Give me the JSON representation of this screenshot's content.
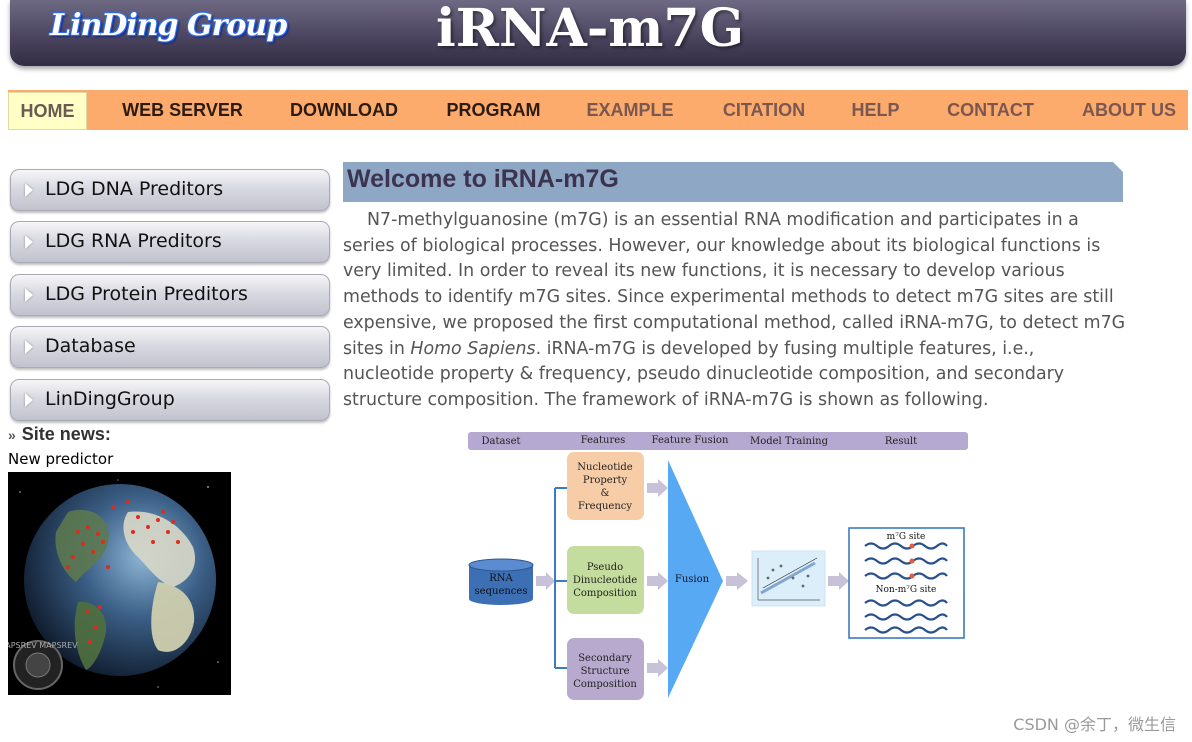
{
  "header": {
    "logo_text": "LinDing Group",
    "title": "iRNA-m7G"
  },
  "nav": {
    "items": [
      {
        "label": "HOME",
        "state": "active"
      },
      {
        "label": "WEB SERVER",
        "state": "normal"
      },
      {
        "label": "DOWNLOAD",
        "state": "normal"
      },
      {
        "label": "PROGRAM",
        "state": "normal"
      },
      {
        "label": "EXAMPLE",
        "state": "dim"
      },
      {
        "label": "CITATION",
        "state": "dim"
      },
      {
        "label": "HELP",
        "state": "dim"
      },
      {
        "label": "CONTACT",
        "state": "dim"
      },
      {
        "label": "ABOUT US",
        "state": "dim"
      }
    ]
  },
  "sidebar": {
    "items": [
      {
        "label": "LDG DNA Preditors"
      },
      {
        "label": "LDG RNA Preditors"
      },
      {
        "label": "LDG Protein Preditors"
      },
      {
        "label": "Database"
      },
      {
        "label": "LinDingGroup"
      }
    ],
    "news_title": "Site news:",
    "news_item": "New predictor",
    "globe_stamp": "MAPSREV MAPSREV"
  },
  "main": {
    "welcome_title": "Welcome to iRNA-m7G",
    "intro_part1": "N7-methylguanosine (m7G) is an essential RNA modification and participates in a series of biological processes. However, our knowledge about its biological functions is very limited. In order to reveal its new functions, it is necessary to develop various methods to identify m7G sites. Since experimental methods to detect m7G sites are still expensive, we proposed the first computational method, called iRNA-m7G, to detect m7G sites in ",
    "intro_italic": "Homo Sapiens",
    "intro_part2": ". iRNA-m7G is developed by fusing multiple features, i.e., nucleotide property & frequency, pseudo dinucleotide composition, and secondary structure composition. The framework of iRNA-m7G is shown as following."
  },
  "figure": {
    "header_labels": [
      "Dataset",
      "Features",
      "Feature Fusion",
      "Model Training",
      "Result"
    ],
    "input_label": [
      "RNA",
      "sequences"
    ],
    "feature_boxes": [
      {
        "lines": [
          "Nucleotide",
          "Property",
          "&",
          "Frequency"
        ],
        "color": "#f7cda8"
      },
      {
        "lines": [
          "Pseudo",
          "Dinucleotide",
          "Composition"
        ],
        "color": "#c4dc9e"
      },
      {
        "lines": [
          "Secondary",
          "Structure",
          "Composition"
        ],
        "color": "#b8aacf"
      }
    ],
    "fusion_label": "Fusion",
    "result_labels": [
      "m⁷G site",
      "Non-m⁷G site"
    ],
    "colors": {
      "header": "#b6a9d1",
      "fusion": "#58a9f4",
      "input": "#3d6fb5",
      "arrow": "#c8c2d8",
      "result_border": "#3b7bbf"
    }
  },
  "watermark": "CSDN @余丁，微生信"
}
